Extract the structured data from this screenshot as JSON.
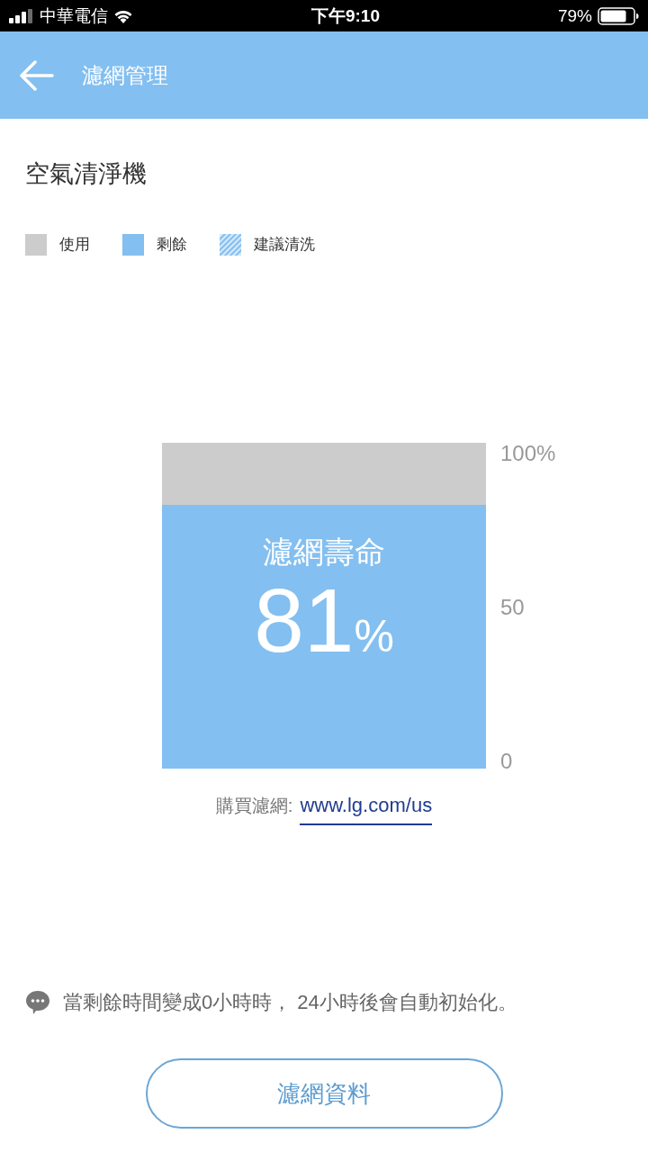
{
  "status_bar": {
    "carrier": "中華電信",
    "time": "下午9:10",
    "battery": "79%"
  },
  "header": {
    "title": "濾網管理"
  },
  "section_title": "空氣清淨機",
  "legend": [
    {
      "label": "使用",
      "kind": "solid",
      "color": "#cccccc"
    },
    {
      "label": "剩餘",
      "kind": "solid",
      "color": "#83bff0"
    },
    {
      "label": "建議清洗",
      "kind": "hatched"
    }
  ],
  "filter_life": {
    "label": "濾網壽命",
    "value": "81",
    "unit": "%",
    "level": 0.81,
    "axis_labels": [
      "100%",
      "50",
      "0"
    ]
  },
  "purchase": {
    "label": "購買濾網:",
    "link": "www.lg.com/us"
  },
  "tip": "當剩餘時間變成0小時時， 24小時後會自動初始化。",
  "button": "濾網資料"
}
